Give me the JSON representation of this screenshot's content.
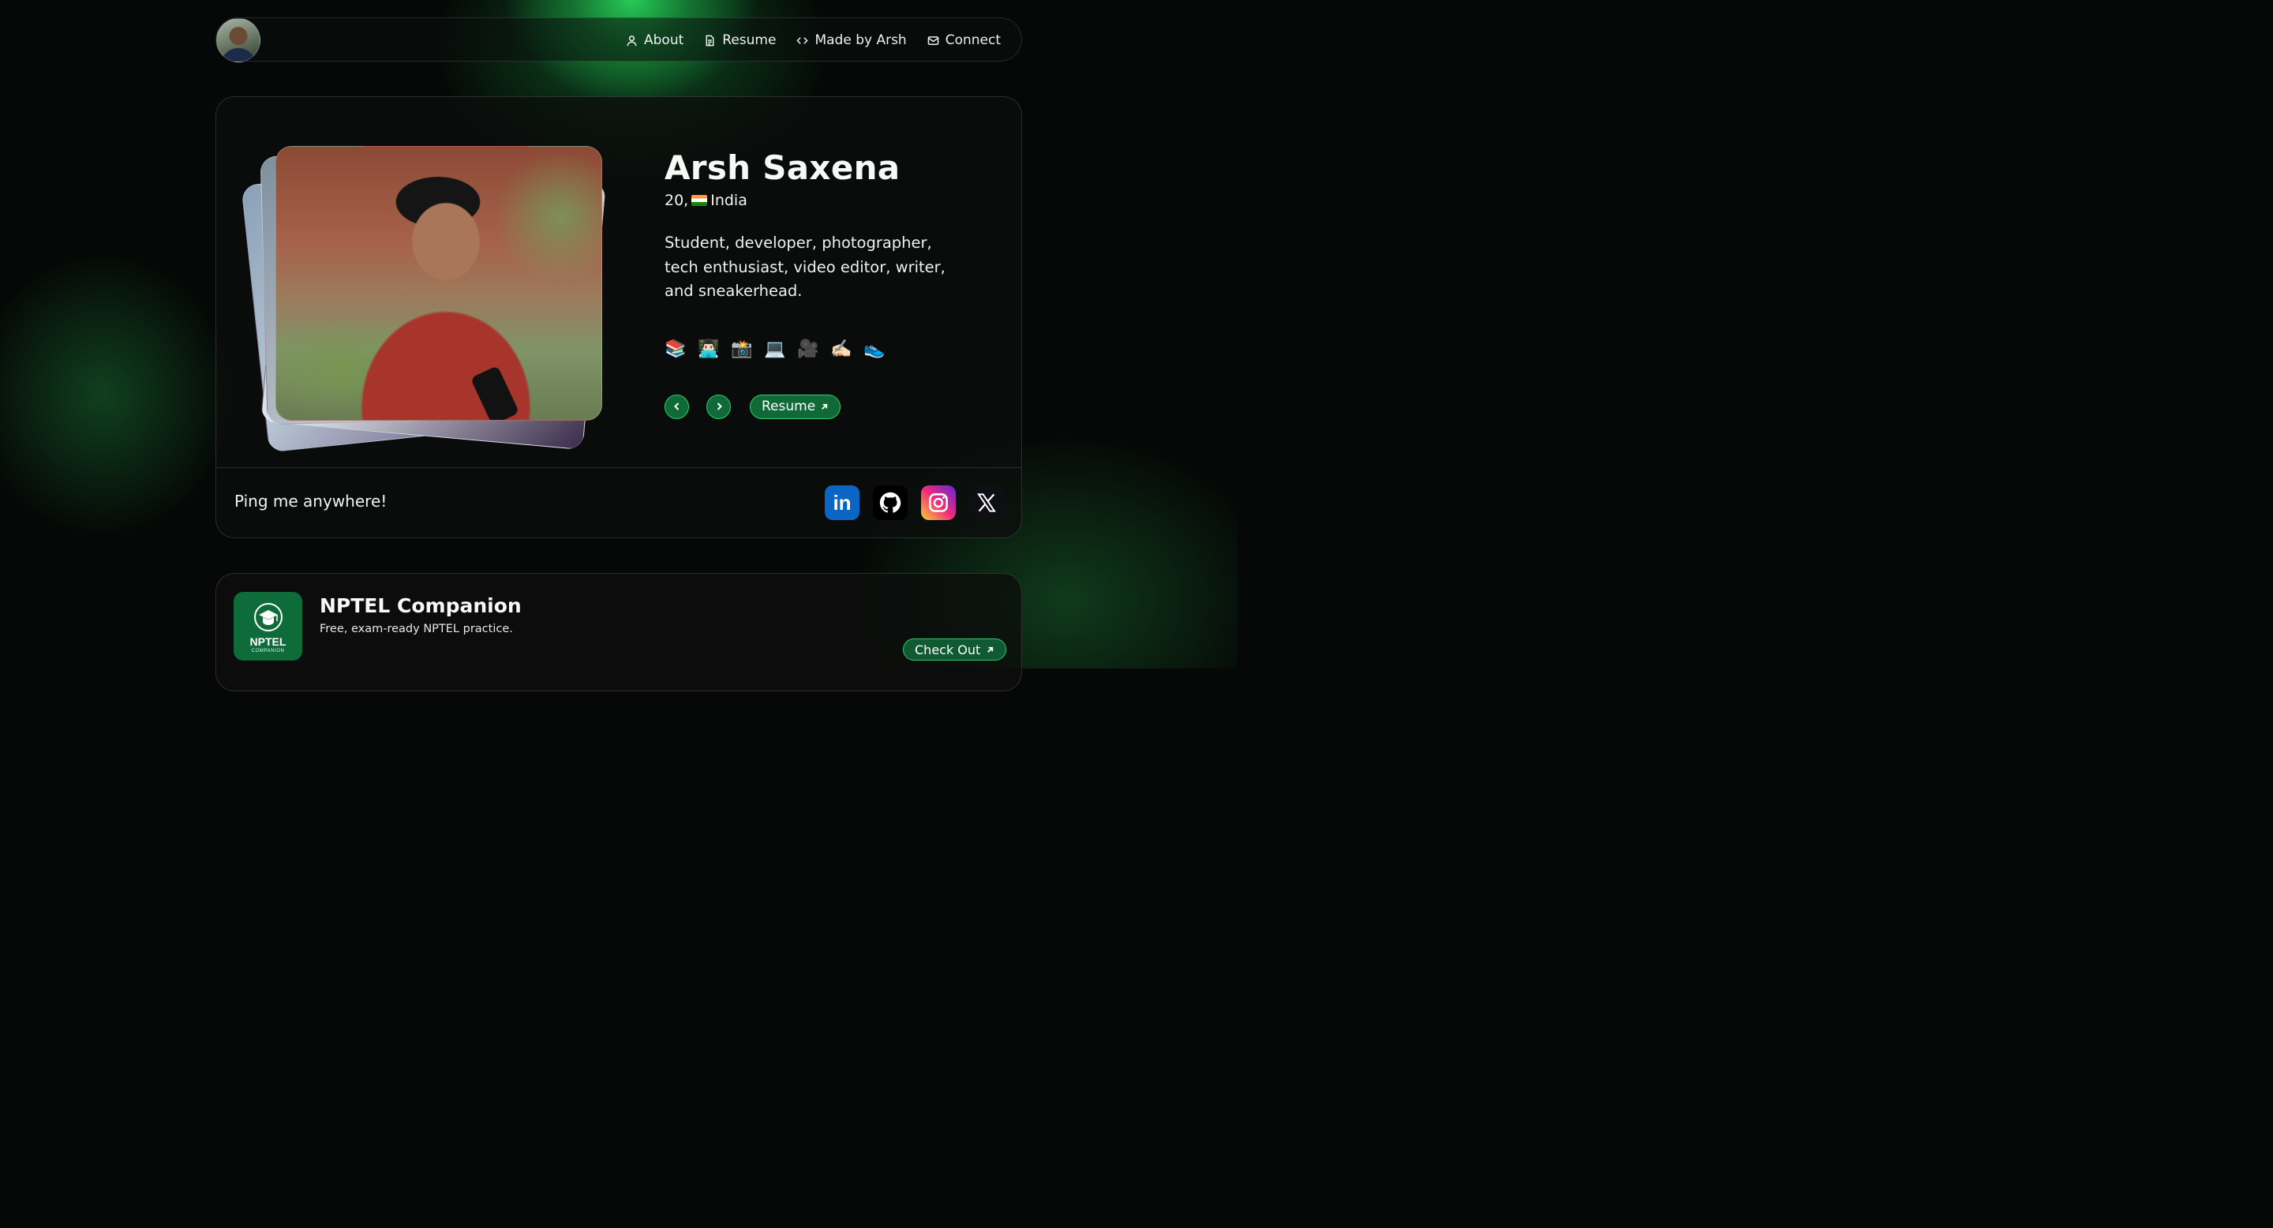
{
  "nav": {
    "links": [
      {
        "label": "About",
        "icon": "user-icon"
      },
      {
        "label": "Resume",
        "icon": "document-icon"
      },
      {
        "label": "Made by Arsh",
        "icon": "code-icon"
      },
      {
        "label": "Connect",
        "icon": "mail-icon"
      }
    ]
  },
  "profile": {
    "name": "Arsh Saxena",
    "age_prefix": "20,",
    "country": "India",
    "bio": "Student, developer, photographer, tech enthusiast, video editor, writer, and sneakerhead.",
    "emojis": [
      "📚",
      "👨🏻‍💻",
      "📸",
      "💻",
      "🎥",
      "✍🏻",
      "👟"
    ],
    "resume_button": "Resume"
  },
  "footer": {
    "ping_text": "Ping me anywhere!",
    "socials": [
      "linkedin-icon",
      "github-icon",
      "instagram-icon",
      "x-icon"
    ]
  },
  "project": {
    "title": "NPTEL Companion",
    "description": "Free, exam-ready NPTEL practice.",
    "button": "Check Out",
    "logo_title": "NPTEL",
    "logo_subtitle": "COMPANION"
  },
  "colors": {
    "accent": "#2ecc6e",
    "button_fill": "#0f6a38",
    "background": "#050806"
  }
}
